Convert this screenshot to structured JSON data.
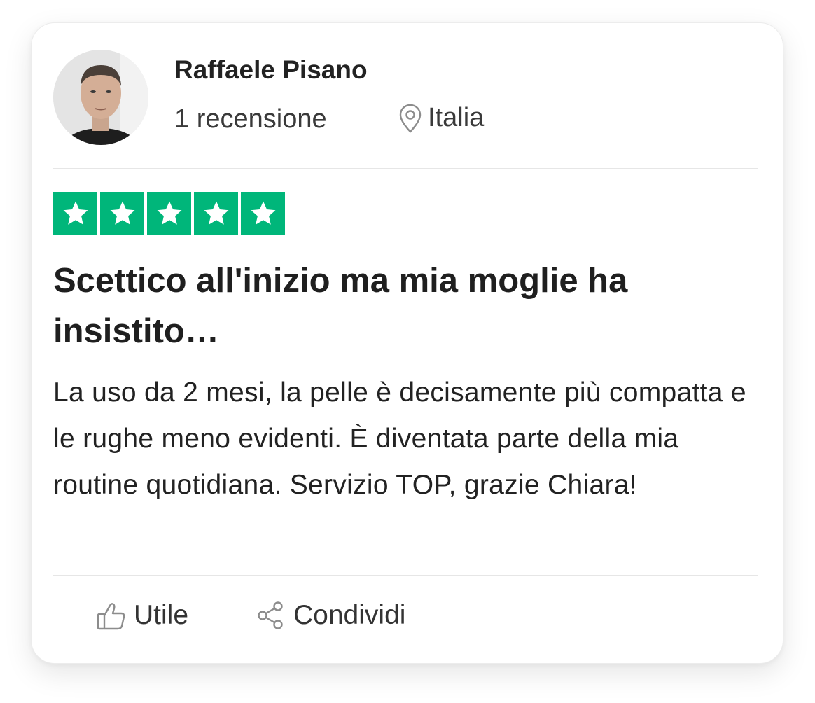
{
  "reviewer": {
    "name": "Raffaele Pisano",
    "review_count": "1 recensione",
    "location": "Italia"
  },
  "rating": {
    "stars": 5,
    "max": 5,
    "color": "#00b67a"
  },
  "review": {
    "title": "Scettico all'inizio ma mia moglie ha insistito…",
    "body": "La uso da 2 mesi, la pelle è decisamente più compatta e le rughe meno evidenti. È diventata parte della mia routine quotidiana. Servizio TOP, grazie Chiara!"
  },
  "actions": {
    "useful_label": "Utile",
    "share_label": "Condividi"
  },
  "icons": {
    "location": "map-pin-icon",
    "useful": "thumbs-up-icon",
    "share": "share-icon",
    "star": "star-icon"
  }
}
